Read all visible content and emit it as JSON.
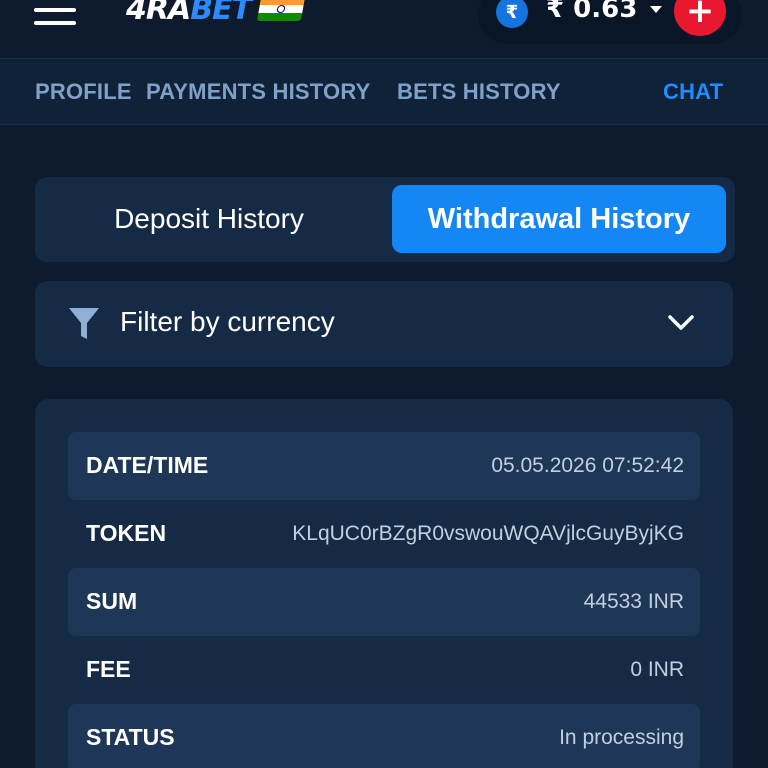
{
  "header": {
    "logo_prefix": "4RA",
    "logo_suffix": "BET",
    "balance_currency_symbol": "₹",
    "balance": "₹ 0.63",
    "add_funds_label": "+"
  },
  "nav": {
    "profile": "PROFILE",
    "payments_history": "PAYMENTS HISTORY",
    "bets_history": "BETS HISTORY",
    "chat": "CHAT"
  },
  "toggle": {
    "deposit_label": "Deposit History",
    "withdrawal_label": "Withdrawal History",
    "active": "Withdrawal History"
  },
  "filter": {
    "label": "Filter by currency"
  },
  "details": {
    "rows": [
      {
        "label": "DATE/TIME",
        "value": "05.05.2026 07:52:42"
      },
      {
        "label": "TOKEN",
        "value": "KLqUC0rBZgR0vswouWQAVjlcGuyByjKG"
      },
      {
        "label": "SUM",
        "value": "44533 INR"
      },
      {
        "label": "FEE",
        "value": "0 INR"
      },
      {
        "label": "STATUS",
        "value": "In processing"
      }
    ]
  },
  "colors": {
    "background": "#0e1b2e",
    "panel": "#152a45",
    "row_shade": "#1e3757",
    "accent_blue": "#1487f5",
    "nav_text": "#7fa1c7",
    "chat_text": "#1f8cff",
    "add_button": "#e8182f"
  },
  "icons": {
    "menu": "hamburger-icon",
    "flag": "india-flag-icon",
    "currency": "rupee-icon",
    "dropdown": "caret-down-icon",
    "add": "plus-icon",
    "filter": "funnel-icon",
    "expand": "chevron-down-icon"
  }
}
